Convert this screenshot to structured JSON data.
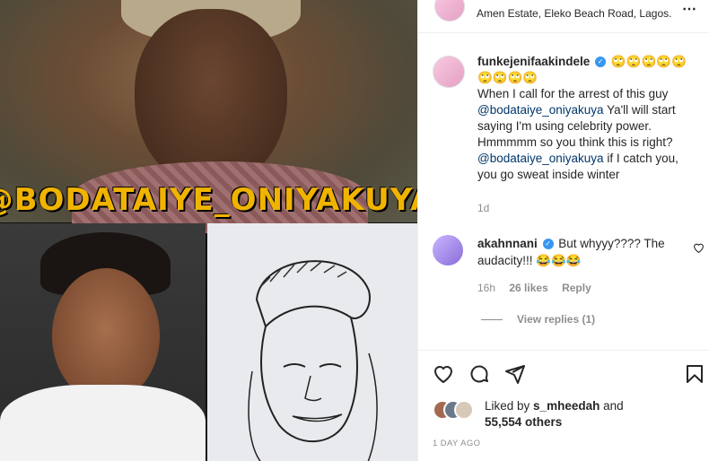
{
  "post": {
    "location": "Amen Estate, Eleko Beach Road, Lagos.",
    "media": {
      "caption_overlay": "@BODATAIYE_ONIYAKUYA"
    },
    "caption": {
      "username": "funkejenifaakindele",
      "emoji_row": "🙄🙄🙄🙄🙄🙄🙄🙄🙄",
      "text_1": "When I call for the arrest of this guy",
      "mention_1": "@bodataiye_oniyakuya",
      "text_2": " Ya'll will start saying I'm using celebrity power. Hmmmmm so you think this is right?",
      "mention_2": "@bodataiye_oniyakuya",
      "text_3": " if I catch you, you go sweat inside winter",
      "time": "1d"
    },
    "comment": {
      "username": "akahnnani",
      "text": " But whyyy???? The audacity!!! ",
      "emojis": "😂😂😂",
      "time": "16h",
      "likes": "26 likes",
      "reply": "Reply",
      "view_replies": "View replies (1)"
    },
    "likes": {
      "prefix": "Liked by ",
      "user": "s_mheedah",
      "middle": " and",
      "count": "55,554 others"
    },
    "date": "1 DAY AGO"
  },
  "icons": {
    "more": "more-icon",
    "heart": "heart-icon",
    "comment": "comment-icon",
    "share": "share-icon",
    "save": "save-icon",
    "verified": "verified-icon"
  },
  "colors": {
    "verified": "#3897f0",
    "mention": "#00376b",
    "muted": "#8e8e8e",
    "overlay_text": "#f0b400"
  }
}
